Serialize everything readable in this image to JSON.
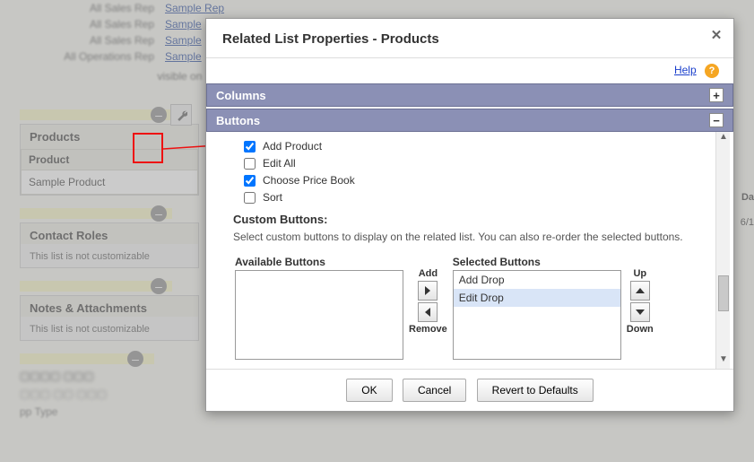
{
  "background": {
    "rows": [
      {
        "label": "All Sales Rep",
        "link": "Sample Rep"
      },
      {
        "label": "All Sales Rep",
        "link": "Sample"
      },
      {
        "label": "All Sales Rep",
        "link": "Sample"
      },
      {
        "label": "All Operations Rep",
        "link": "Sample"
      }
    ],
    "visible_text": "visible on",
    "products_panel": {
      "title": "Products",
      "col_header": "Product",
      "row_value": "Sample Product",
      "side_col": "Date"
    },
    "contact_roles_panel": {
      "title": "Contact Roles",
      "note": "This list is not customizable"
    },
    "notes_panel": {
      "title": "Notes & Attachments",
      "note": "This list is not customizable"
    },
    "bottom_blur": {
      "l1": "—",
      "l2": "—",
      "l3": "pp Type"
    }
  },
  "modal": {
    "title": "Related List Properties - Products",
    "help": "Help",
    "columns_section": "Columns",
    "buttons_section": "Buttons",
    "standard_buttons": [
      {
        "label": "Add Product",
        "checked": true
      },
      {
        "label": "Edit All",
        "checked": false
      },
      {
        "label": "Choose Price Book",
        "checked": true
      },
      {
        "label": "Sort",
        "checked": false
      }
    ],
    "custom_heading": "Custom Buttons:",
    "custom_desc": "Select custom buttons to display on the related list. You can also re-order the selected buttons.",
    "available_label": "Available Buttons",
    "selected_label": "Selected Buttons",
    "selected_items": [
      {
        "label": "Add Drop",
        "selected": false
      },
      {
        "label": "Edit Drop",
        "selected": true
      }
    ],
    "arrow_labels": {
      "add": "Add",
      "remove": "Remove",
      "up": "Up",
      "down": "Down"
    },
    "footer": {
      "ok": "OK",
      "cancel": "Cancel",
      "revert": "Revert to Defaults"
    }
  }
}
